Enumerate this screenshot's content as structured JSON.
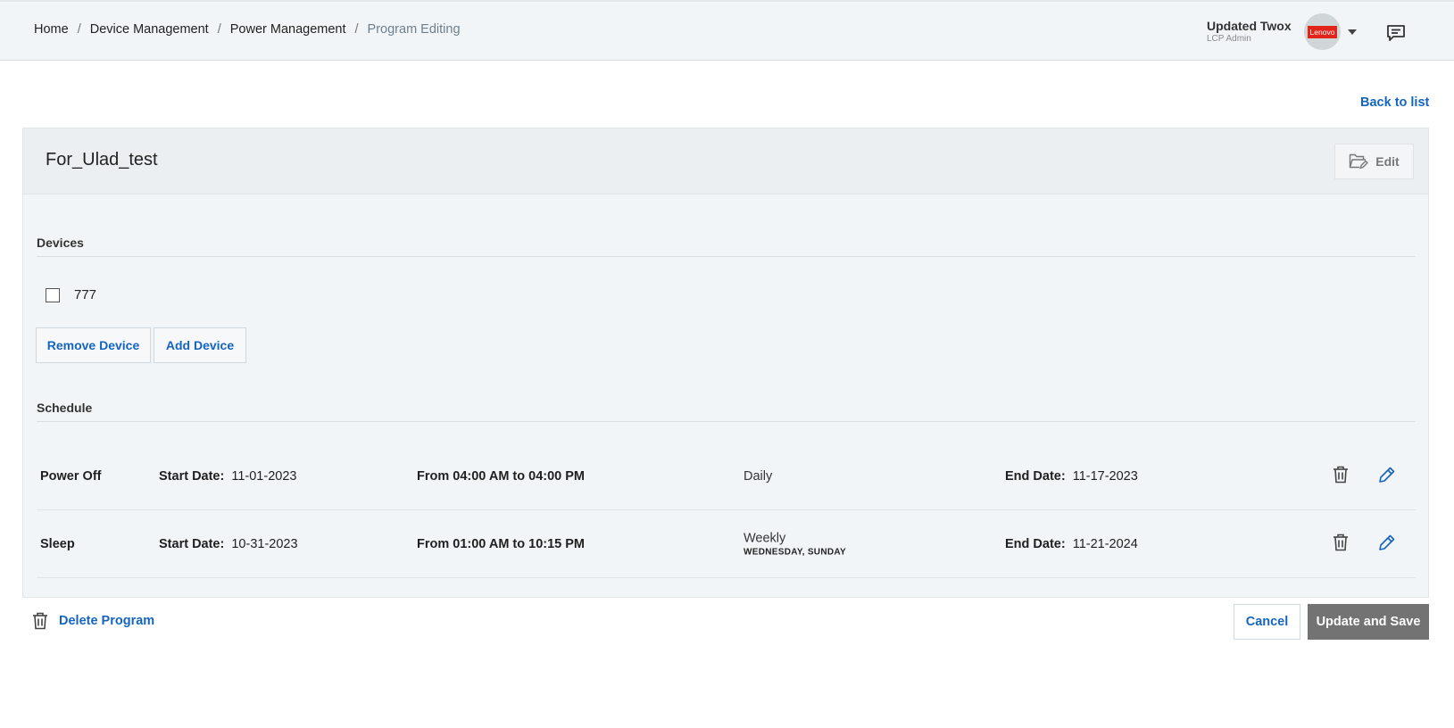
{
  "breadcrumb": {
    "items": [
      "Home",
      "Device Management",
      "Power Management"
    ],
    "separator": "/",
    "current": "Program Editing"
  },
  "user": {
    "name": "Updated Twox",
    "role": "LCP Admin",
    "avatar_logo_text": "Lenovo"
  },
  "back_link": "Back to list",
  "program": {
    "title": "For_Ulad_test",
    "edit_label": "Edit"
  },
  "devices": {
    "section_label": "Devices",
    "items": [
      {
        "name": "777"
      }
    ],
    "remove_label": "Remove Device",
    "add_label": "Add Device"
  },
  "schedule": {
    "section_label": "Schedule",
    "rows": [
      {
        "action": "Power Off",
        "start_label": "Start Date:",
        "start_date": "11-01-2023",
        "time_range": "From 04:00 AM to 04:00 PM",
        "frequency": "Daily",
        "days": "",
        "end_label": "End Date:",
        "end_date": "11-17-2023"
      },
      {
        "action": "Sleep",
        "start_label": "Start Date:",
        "start_date": "10-31-2023",
        "time_range": "From 01:00 AM to 10:15 PM",
        "frequency": "Weekly",
        "days": "WEDNESDAY, SUNDAY",
        "end_label": "End Date:",
        "end_date": "11-21-2024"
      }
    ]
  },
  "footer": {
    "delete_label": "Delete Program",
    "cancel_label": "Cancel",
    "save_label": "Update and Save"
  },
  "colors": {
    "link": "#1565c0",
    "primary_button": "#737373",
    "header_bg": "#f1f5f7",
    "card_bg": "#f2f5f7",
    "brand_red": "#e2231a"
  }
}
